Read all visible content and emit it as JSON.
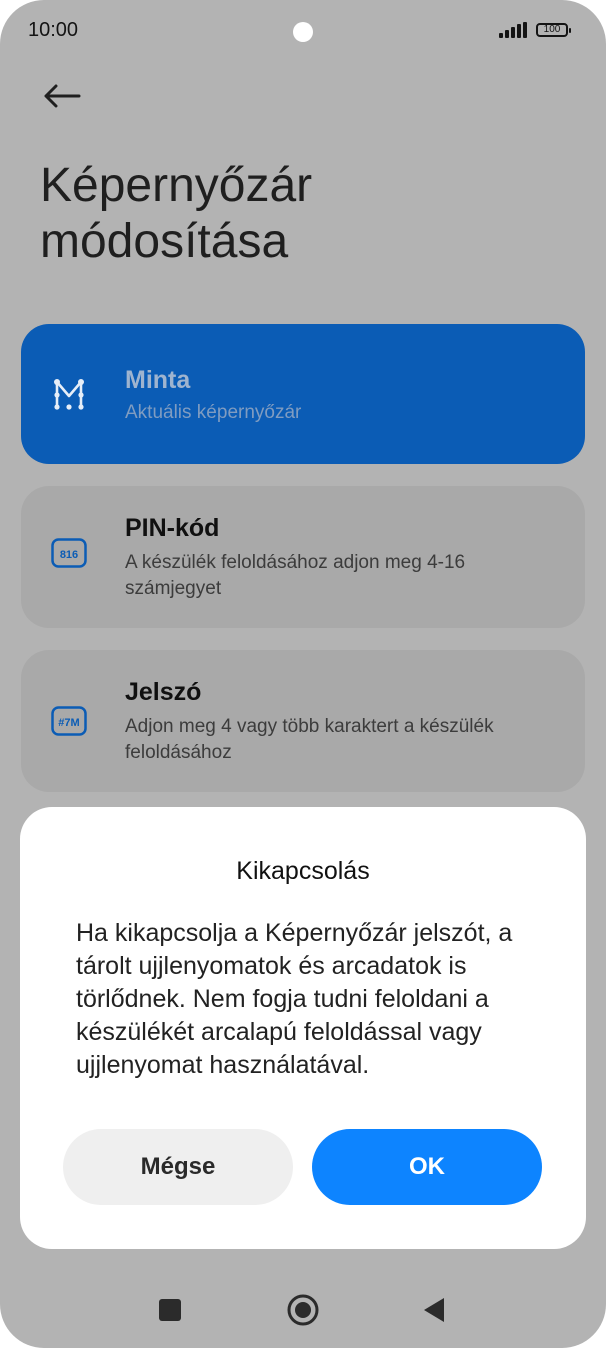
{
  "status_bar": {
    "time": "10:00",
    "battery": "100"
  },
  "header": {
    "title": "Képernyőzár módosítása"
  },
  "options": [
    {
      "title": "Minta",
      "subtitle": "Aktuális képernyőzár",
      "icon": "pattern-icon"
    },
    {
      "title": "PIN-kód",
      "subtitle": "A készülék feloldásához adjon meg 4-16 számjegyet",
      "icon": "pin-icon",
      "icon_text": "816"
    },
    {
      "title": "Jelszó",
      "subtitle": "Adjon meg 4 vagy több karaktert a készülék feloldásához",
      "icon": "password-icon",
      "icon_text": "#7M"
    }
  ],
  "dialog": {
    "title": "Kikapcsolás",
    "message": "Ha kikapcsolja a Képernyőzár jelszót, a tárolt ujjlenyomatok és arcadatok is törlődnek. Nem fogja tudni feloldani a készülékét arcalapú feloldással vagy ujjlenyomat használatával.",
    "cancel_label": "Mégse",
    "ok_label": "OK"
  },
  "colors": {
    "selected_card": "#0b5cb5",
    "ok_button": "#0d84ff",
    "overlay": "#b3b3b3"
  }
}
